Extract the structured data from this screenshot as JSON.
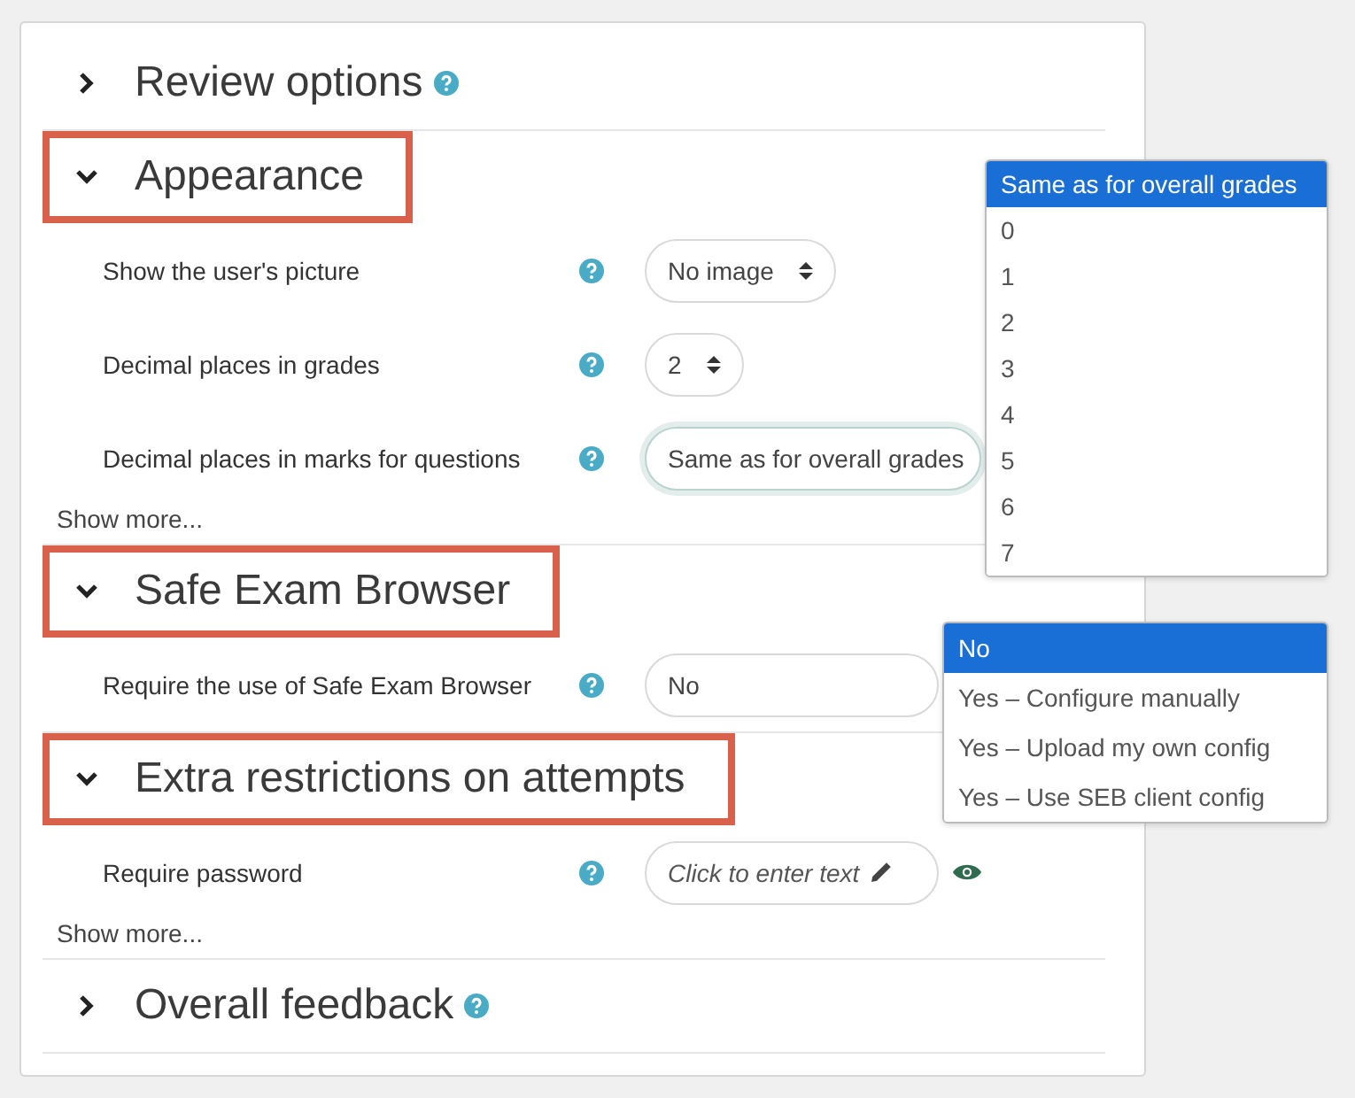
{
  "sections": [
    {
      "title": "Review options",
      "expanded": false,
      "highlighted": false,
      "help": true
    },
    {
      "title": "Appearance",
      "expanded": true,
      "highlighted": true,
      "help": false,
      "show_more": "Show more...",
      "fields": [
        {
          "label": "Show the user's picture",
          "kind": "select",
          "value": "No image",
          "caret": true,
          "focused": false
        },
        {
          "label": "Decimal places in grades",
          "kind": "select",
          "value": "2",
          "caret": true,
          "focused": false
        },
        {
          "label": "Decimal places in marks for questions",
          "kind": "select",
          "value": "Same as for overall grades",
          "caret": false,
          "focused": true,
          "options": [
            {
              "label": "Same as for overall grades",
              "selected": true
            },
            {
              "label": "0",
              "selected": false
            },
            {
              "label": "1",
              "selected": false
            },
            {
              "label": "2",
              "selected": false
            },
            {
              "label": "3",
              "selected": false
            },
            {
              "label": "4",
              "selected": false
            },
            {
              "label": "5",
              "selected": false
            },
            {
              "label": "6",
              "selected": false
            },
            {
              "label": "7",
              "selected": false
            }
          ]
        }
      ]
    },
    {
      "title": "Safe Exam Browser",
      "expanded": true,
      "highlighted": true,
      "help": false,
      "fields": [
        {
          "label": "Require the use of Safe Exam Browser",
          "kind": "select",
          "value": "No",
          "caret": false,
          "focused": false,
          "options": [
            {
              "label": "No",
              "selected": true
            },
            {
              "label": "Yes – Configure manually",
              "selected": false
            },
            {
              "label": "Yes – Upload my own config",
              "selected": false
            },
            {
              "label": "Yes – Use SEB client config",
              "selected": false
            }
          ]
        }
      ]
    },
    {
      "title": "Extra restrictions on attempts",
      "expanded": true,
      "highlighted": true,
      "help": false,
      "show_more": "Show more...",
      "fields": [
        {
          "label": "Require password",
          "kind": "text",
          "placeholder": "Click to enter text",
          "reveal": true
        }
      ]
    },
    {
      "title": "Overall feedback",
      "expanded": false,
      "highlighted": false,
      "help": true
    }
  ]
}
